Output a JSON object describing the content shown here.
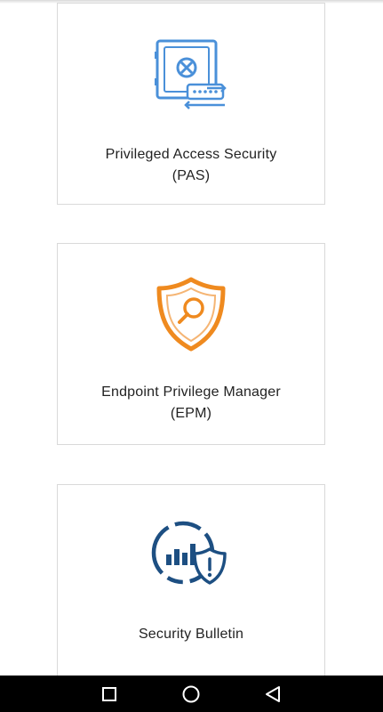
{
  "cards": [
    {
      "title_line1": "Privileged Access Security",
      "title_line2": "(PAS)",
      "icon": "vault-icon",
      "color": "#4a90d9"
    },
    {
      "title_line1": "Endpoint Privilege Manager",
      "title_line2": "(EPM)",
      "icon": "shield-search-icon",
      "color": "#ef8a1f"
    },
    {
      "title_line1": "Security Bulletin",
      "title_line2": "",
      "icon": "bulletin-shield-icon",
      "color": "#1d4f82"
    }
  ],
  "nav": {
    "recents_icon": "square-icon",
    "home_icon": "circle-icon",
    "back_icon": "triangle-back-icon"
  }
}
